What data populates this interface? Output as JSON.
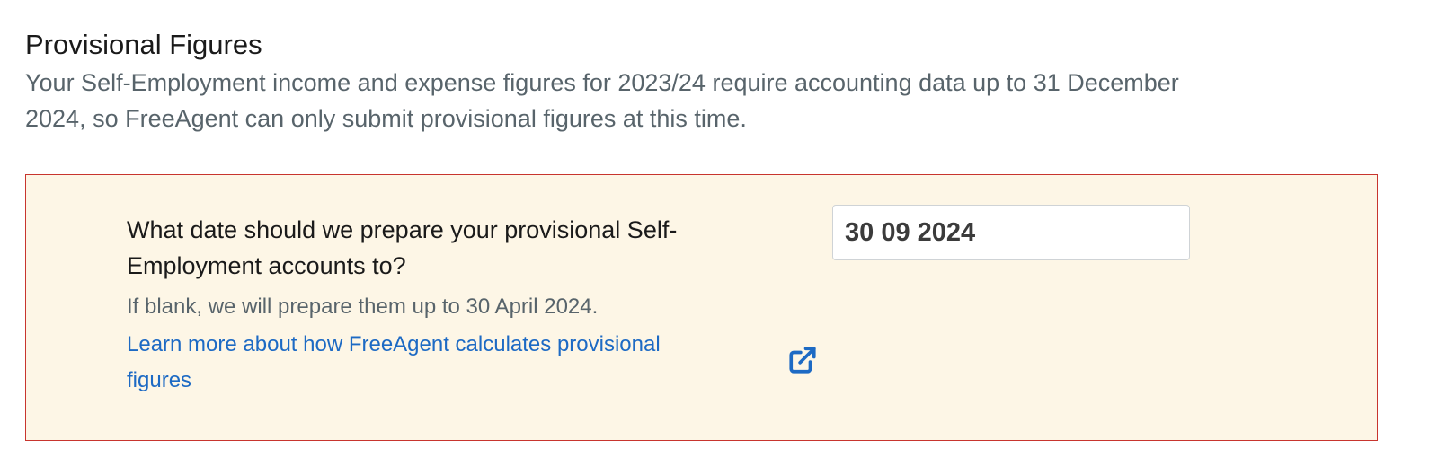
{
  "section": {
    "title": "Provisional Figures",
    "description": "Your Self-Employment income and expense figures for 2023/24 require accounting data up to 31 December 2024, so FreeAgent can only submit provisional figures at this time."
  },
  "panel": {
    "question": "What date should we prepare your provisional Self-Employment accounts to?",
    "hint": "If blank, we will prepare them up to 30 April 2024.",
    "learn_more_link": "Learn more about how FreeAgent calculates provisional figures",
    "learn_more_icon": "external-link-icon",
    "date_value": "30 09 2024"
  },
  "colors": {
    "panel_background": "#fdf6e6",
    "panel_border": "#c8352e",
    "link": "#1d6ac4",
    "muted_text": "#58646b"
  }
}
